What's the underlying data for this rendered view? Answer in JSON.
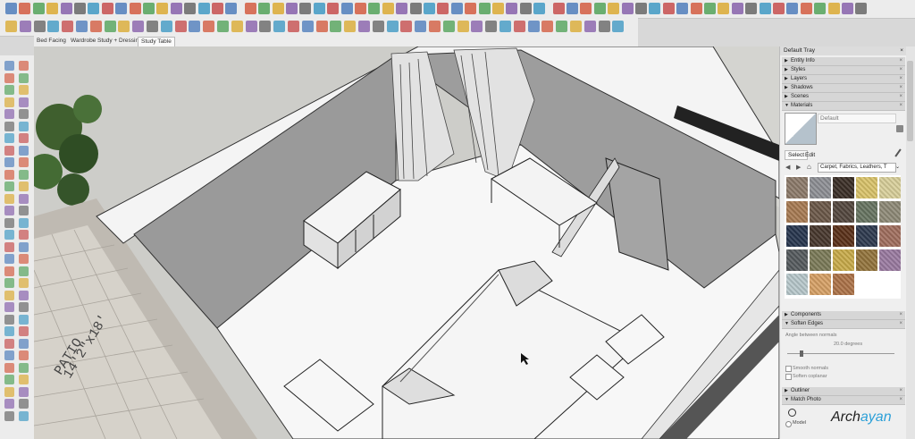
{
  "scene_tabs": [
    {
      "label": "Bed Facing"
    },
    {
      "label": "Wardrobe"
    },
    {
      "label": "Study + Dressing"
    },
    {
      "label": "Study Table"
    }
  ],
  "active_tab_index": 3,
  "tray": {
    "title": "Default Tray",
    "panels": {
      "entity_info": "Entity Info",
      "styles": "Styles",
      "layers": "Layers",
      "shadows": "Shadows",
      "scenes": "Scenes",
      "materials": "Materials",
      "components": "Components",
      "soften_edges": "Soften Edges",
      "outliner": "Outliner",
      "match_photo": "Match Photo"
    },
    "materials": {
      "current_name": "Default",
      "select_tab": "Select",
      "edit_tab": "Edit",
      "category": "Carpet, Fabrics, Leathers, T",
      "swatches": [
        "#8c7a6a",
        "#8d8f94",
        "#3a2e26",
        "#d9c36a",
        "#d8cf9a",
        "#a77a52",
        "#6b5848",
        "#53473e",
        "#677461",
        "#8e8a77",
        "#27364e",
        "#47372d",
        "#5a3018",
        "#2e3a4f",
        "#a06e5e",
        "#555a5d",
        "#7b7a58",
        "#c8ab4a",
        "#93743c",
        "#9a7aa0",
        "#b7c7cb",
        "#d6a065",
        "#ad7348"
      ]
    },
    "soften_edges": {
      "angle_label": "Angle between normals",
      "angle_value": "20.0  degrees",
      "smooth_normals": "Smooth normals",
      "soften_coplanar": "Soften coplanar"
    },
    "match_photo": {
      "model_label": "Model"
    }
  },
  "viewport": {
    "floor_label": "PATIO",
    "floor_dimension": "14'2\"x18'"
  },
  "watermark": {
    "text": "Arch",
    "accent": "ayan"
  },
  "colors": {
    "wall_gray": "#9a9a9a",
    "floor_white": "#f7f7f7",
    "toolbar_bg": "#ececec",
    "tray_bg": "#efefef",
    "watermark_accent": "#2ca0d8"
  }
}
